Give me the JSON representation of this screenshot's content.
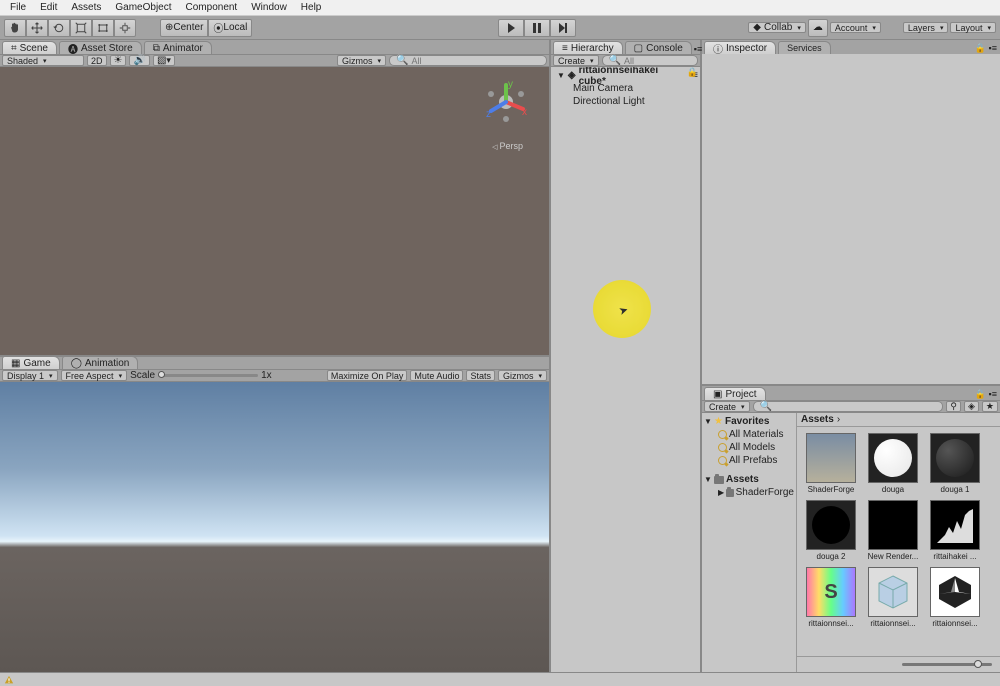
{
  "menu": {
    "items": [
      "File",
      "Edit",
      "Assets",
      "GameObject",
      "Component",
      "Window",
      "Help"
    ]
  },
  "toolbar": {
    "pivot": "Center",
    "handle": "Local",
    "collab": "Collab",
    "account": "Account",
    "layers": "Layers",
    "layout": "Layout"
  },
  "scene": {
    "tab_scene": "Scene",
    "tab_assetstore": "Asset Store",
    "tab_animator": "Animator",
    "shading": "Shaded",
    "mode2d": "2D",
    "gizmos": "Gizmos",
    "search_placeholder": "All",
    "persp": "Persp"
  },
  "game": {
    "tab_game": "Game",
    "tab_animation": "Animation",
    "display": "Display 1",
    "aspect": "Free Aspect",
    "scale_label": "Scale",
    "scale_value": "1x",
    "maximize": "Maximize On Play",
    "mute": "Mute Audio",
    "stats": "Stats",
    "gizmos": "Gizmos"
  },
  "hierarchy": {
    "tab_hierarchy": "Hierarchy",
    "tab_console": "Console",
    "create": "Create",
    "search_placeholder": "All",
    "scene_name": "rittaionnseihakei cube*",
    "items": [
      "Main Camera",
      "Directional Light"
    ]
  },
  "inspector": {
    "tab_inspector": "Inspector",
    "tab_services": "Services"
  },
  "project": {
    "tab_project": "Project",
    "create": "Create",
    "search_placeholder": "",
    "favorites_label": "Favorites",
    "favorites": [
      "All Materials",
      "All Models",
      "All Prefabs"
    ],
    "assets_label": "Assets",
    "tree_items": [
      "ShaderForge"
    ],
    "breadcrumb": "Assets",
    "items": [
      {
        "label": "ShaderForge",
        "kind": "folder"
      },
      {
        "label": "douga",
        "kind": "circle_white"
      },
      {
        "label": "douga 1",
        "kind": "sphere_dark"
      },
      {
        "label": "douga 2",
        "kind": "circle_black"
      },
      {
        "label": "New Render...",
        "kind": "black"
      },
      {
        "label": "rittaihakei ...",
        "kind": "histogram"
      },
      {
        "label": "rittaionnsei...",
        "kind": "sf_rainbow"
      },
      {
        "label": "rittaionnsei...",
        "kind": "cube"
      },
      {
        "label": "rittaionnsei...",
        "kind": "unity"
      }
    ]
  },
  "status": {
    "text": ""
  }
}
